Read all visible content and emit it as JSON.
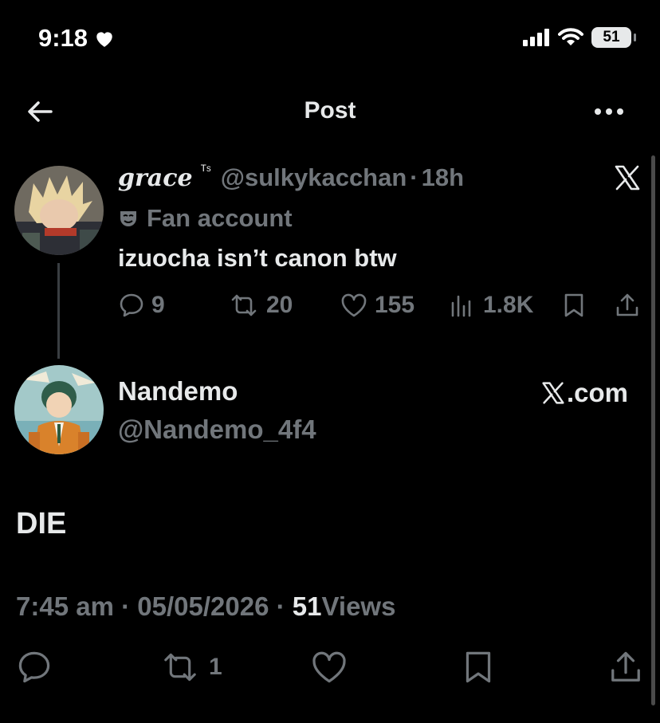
{
  "status_bar": {
    "time": "9:18",
    "battery": "51"
  },
  "header": {
    "title": "Post"
  },
  "quoted_tweet": {
    "name": "grace",
    "name_suffix": "ᵀˢ",
    "handle": "@sulkykacchan",
    "separator": "·",
    "age": "18h",
    "label": "Fan account",
    "text": "izuocha isn’t canon btw",
    "replies": "9",
    "reposts": "20",
    "likes": "155",
    "views": "1.8K"
  },
  "reply": {
    "name": "Nandemo",
    "handle": "@Nandemo_4f4",
    "source": ".com",
    "text": "DIE",
    "time": "7:45 am",
    "date": "05/05/2026",
    "sep": "·",
    "views_count": "51",
    "views_label": "Views",
    "reposts": "1"
  }
}
